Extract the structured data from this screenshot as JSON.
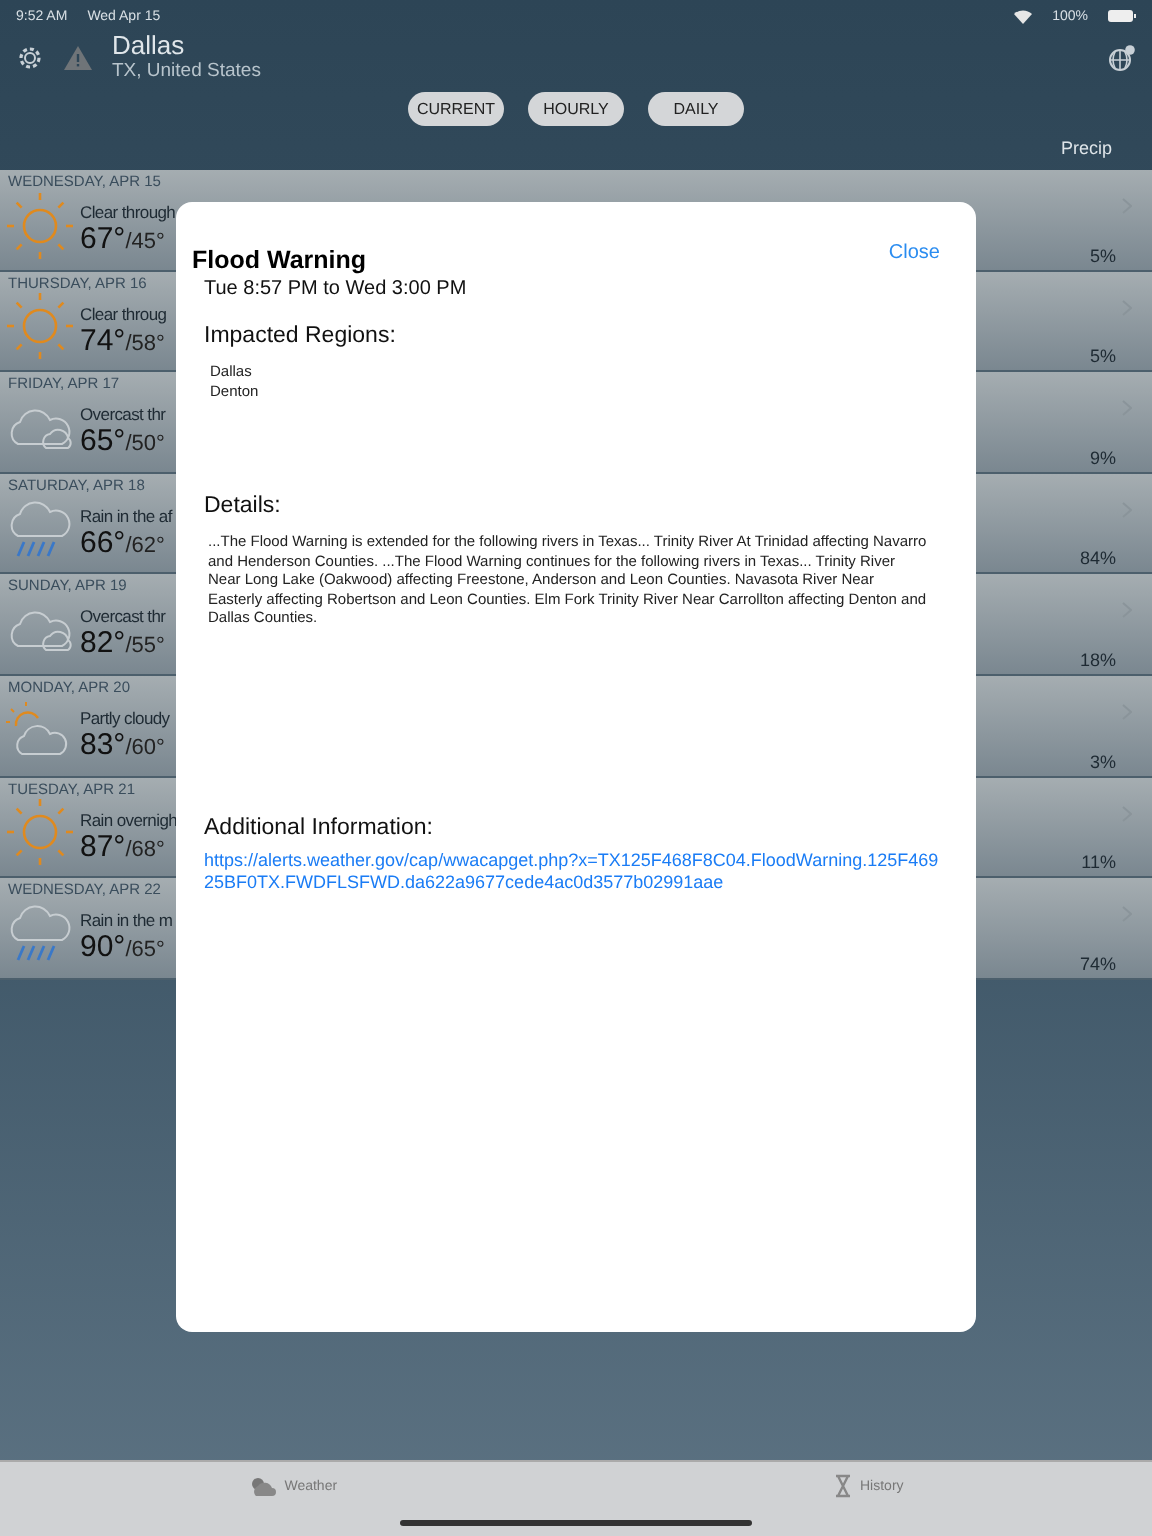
{
  "status_bar": {
    "time": "9:52 AM",
    "date": "Wed Apr 15",
    "battery": "100%"
  },
  "header": {
    "city": "Dallas",
    "region": "TX, United States"
  },
  "segments": [
    {
      "label": "CURRENT"
    },
    {
      "label": "HOURLY"
    },
    {
      "label": "DAILY"
    }
  ],
  "precip_header": "Precip",
  "days": [
    {
      "date": "WEDNESDAY, APR 15",
      "kind": "sunny",
      "summary": "Clear through",
      "high": "67°",
      "low": "/45°",
      "precip": "5%"
    },
    {
      "date": "THURSDAY, APR 16",
      "kind": "sunny",
      "summary": "Clear throug",
      "high": "74°",
      "low": "/58°",
      "precip": "5%"
    },
    {
      "date": "FRIDAY, APR 17",
      "kind": "cloudy",
      "summary": "Overcast thr",
      "high": "65°",
      "low": "/50°",
      "precip": "9%"
    },
    {
      "date": "SATURDAY, APR 18",
      "kind": "rain",
      "summary": "Rain in the af",
      "high": "66°",
      "low": "/62°",
      "precip": "84%"
    },
    {
      "date": "SUNDAY, APR 19",
      "kind": "cloudy",
      "summary": "Overcast thr",
      "high": "82°",
      "low": "/55°",
      "precip": "18%"
    },
    {
      "date": "MONDAY, APR 20",
      "kind": "partly_cloudy",
      "summary": "Partly cloudy",
      "high": "83°",
      "low": "/60°",
      "precip": "3%"
    },
    {
      "date": "TUESDAY, APR 21",
      "kind": "sunny",
      "summary": "Rain overnigh",
      "high": "87°",
      "low": "/68°",
      "precip": "11%"
    },
    {
      "date": "WEDNESDAY, APR 22",
      "kind": "rain",
      "summary": "Rain in the m",
      "high": "90°",
      "low": "/65°",
      "precip": "74%"
    }
  ],
  "alert": {
    "title": "Flood Warning",
    "close": "Close",
    "period": "Tue 8:57 PM to Wed 3:00 PM",
    "regions_heading": "Impacted Regions:",
    "regions": [
      "Dallas",
      "Denton"
    ],
    "details_heading": "Details:",
    "details": "...The Flood Warning is extended for the following rivers in Texas... Trinity River At Trinidad affecting Navarro and Henderson Counties. ...The Flood Warning continues for the following rivers in Texas... Trinity River Near Long Lake (Oakwood) affecting Freestone, Anderson and Leon Counties. Navasota River Near Easterly affecting Robertson and Leon Counties. Elm Fork Trinity River Near Carrollton affecting Denton and Dallas Counties.",
    "info_heading": "Additional Information:",
    "link": "https://alerts.weather.gov/cap/wwacapget.php?x=TX125F468F8C04.FloodWarning.125F46925BF0TX.FWDFLSFWD.da622a9677cede4ac0d3577b02991aae"
  },
  "tab_bar": [
    {
      "label": "Weather",
      "kind": "weather"
    },
    {
      "label": "History",
      "kind": "history"
    }
  ]
}
